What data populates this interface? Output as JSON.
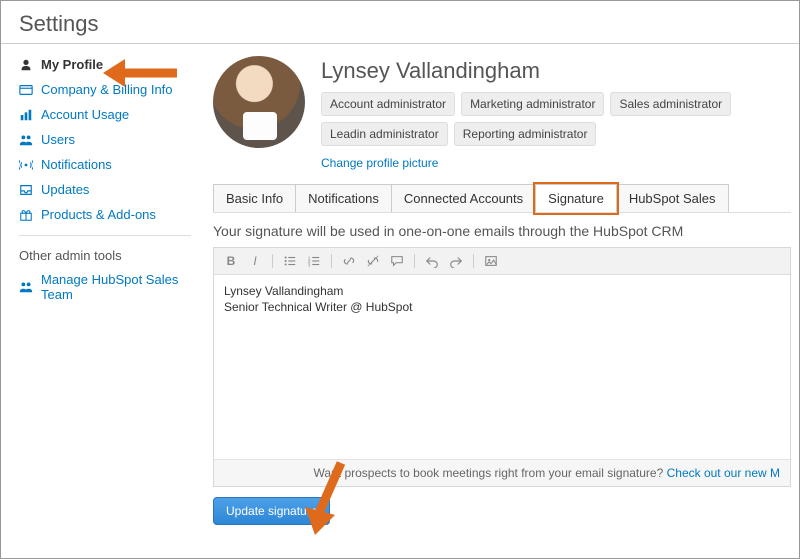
{
  "page_title": "Settings",
  "sidebar": {
    "items": [
      {
        "label": "My Profile"
      },
      {
        "label": "Company & Billing Info"
      },
      {
        "label": "Account Usage"
      },
      {
        "label": "Users"
      },
      {
        "label": "Notifications"
      },
      {
        "label": "Updates"
      },
      {
        "label": "Products & Add-ons"
      }
    ],
    "other_tools_heading": "Other admin tools",
    "other_items": [
      {
        "label": "Manage HubSpot Sales Team"
      }
    ]
  },
  "profile": {
    "name": "Lynsey Vallandingham",
    "roles": [
      "Account administrator",
      "Marketing administrator",
      "Sales administrator",
      "Leadin administrator",
      "Reporting administrator"
    ],
    "change_picture": "Change profile picture"
  },
  "tabs": [
    {
      "label": "Basic Info"
    },
    {
      "label": "Notifications"
    },
    {
      "label": "Connected Accounts"
    },
    {
      "label": "Signature"
    },
    {
      "label": "HubSpot Sales"
    }
  ],
  "signature": {
    "description": "Your signature will be used in one-on-one emails through the HubSpot CRM",
    "content_line1": "Lynsey Vallandingham",
    "content_line2": "Senior Technical Writer @ HubSpot",
    "footer_text": "Want prospects to book meetings right from your email signature? ",
    "footer_link": "Check out our new M",
    "update_button": "Update signature"
  },
  "toolbar_icons": [
    "B",
    "I",
    "ul",
    "ol",
    "link",
    "unlink",
    "comment",
    "undo",
    "redo",
    "image"
  ]
}
